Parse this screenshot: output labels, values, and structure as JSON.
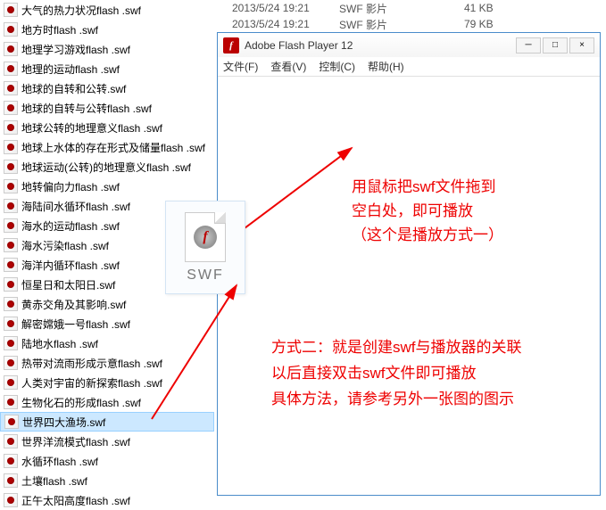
{
  "files": [
    "大气的热力状况flash .swf",
    "地方时flash .swf",
    "地理学习游戏flash .swf",
    "地理的运动flash .swf",
    "地球的自转和公转.swf",
    "地球的自转与公转flash .swf",
    "地球公转的地理意义flash .swf",
    "地球上水体的存在形式及储量flash .swf",
    "地球运动(公转)的地理意义flash .swf",
    "地转偏向力flash .swf",
    "海陆间水循环flash .swf",
    "海水的运动flash .swf",
    "海水污染flash .swf",
    "海洋内循环flash .swf",
    "恒星日和太阳日.swf",
    "黄赤交角及其影响.swf",
    "解密嫦娥一号flash .swf",
    "陆地水flash .swf",
    "热带对流雨形成示意flash .swf",
    "人类对宇宙的新探索flash .swf",
    "生物化石的形成flash .swf",
    "世界四大渔场.swf",
    "世界洋流模式flash .swf",
    "水循环flash .swf",
    "土壤flash .swf",
    "正午太阳高度flash .swf"
  ],
  "selected_index": 21,
  "details": {
    "rows": [
      {
        "date": "2013/5/24 19:21",
        "type": "SWF 影片",
        "size": "41 KB"
      },
      {
        "date": "2013/5/24 19:21",
        "type": "SWF 影片",
        "size": "79 KB"
      }
    ]
  },
  "window": {
    "title": "Adobe Flash Player 12",
    "logo_char": "f",
    "controls": {
      "min": "─",
      "max": "□",
      "close": "×"
    }
  },
  "menu": {
    "file": "文件(F)",
    "view": "查看(V)",
    "control": "控制(C)",
    "help": "帮助(H)"
  },
  "annotation1": {
    "line1": "用鼠标把swf文件拖到",
    "line2": "空白处，即可播放",
    "line3": "（这个是播放方式一）"
  },
  "annotation2": {
    "line1": "方式二：就是创建swf与播放器的关联",
    "line2": "以后直接双击swf文件即可播放",
    "line3": "具体方法，请参考另外一张图的图示"
  },
  "drag_icon": {
    "logo": "f",
    "ext": "SWF"
  }
}
